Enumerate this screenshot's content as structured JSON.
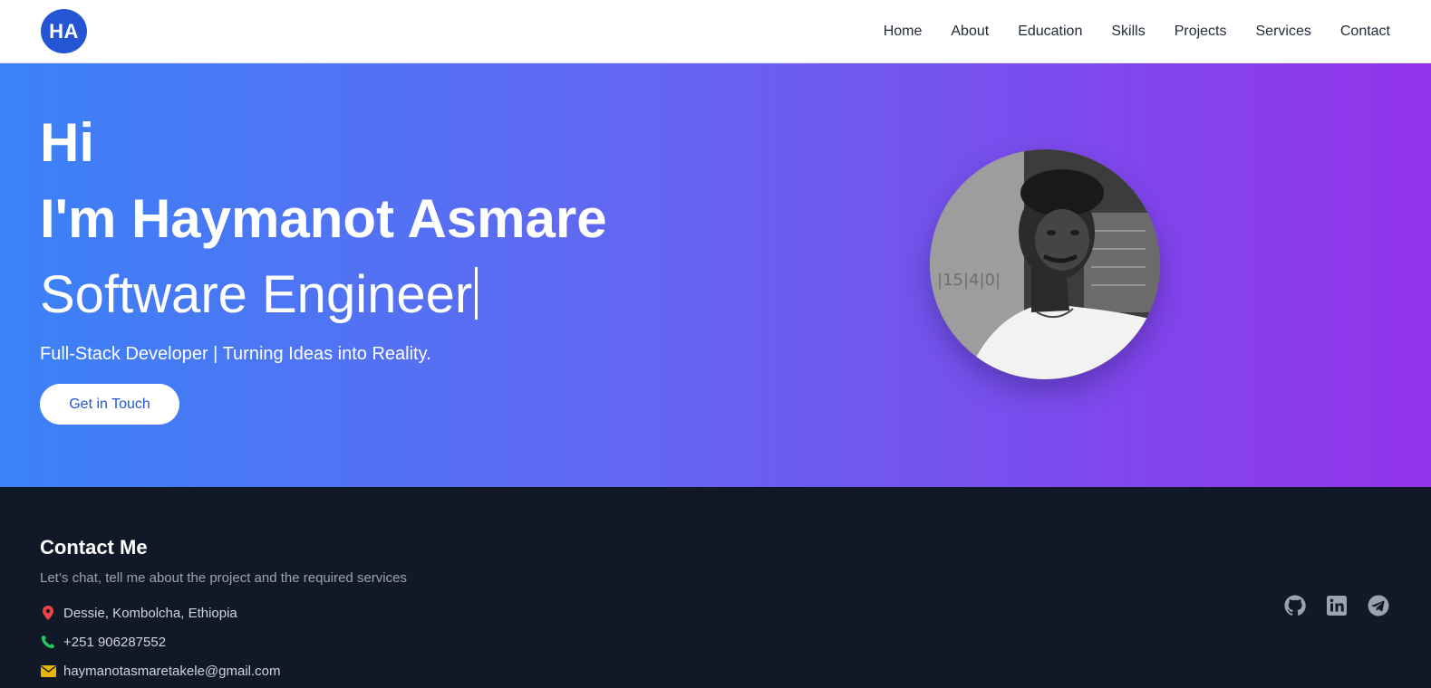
{
  "header": {
    "logo_text": "HA",
    "nav": [
      {
        "label": "Home"
      },
      {
        "label": "About"
      },
      {
        "label": "Education"
      },
      {
        "label": "Skills"
      },
      {
        "label": "Projects"
      },
      {
        "label": "Services"
      },
      {
        "label": "Contact"
      }
    ]
  },
  "hero": {
    "greeting": "Hi",
    "name": "I'm Haymanot Asmare",
    "role": "Software Engineer",
    "tagline": "Full-Stack Developer | Turning Ideas into Reality.",
    "cta_label": "Get in Touch",
    "gradient_colors": [
      "#3b82f6",
      "#6366f1",
      "#9333ea"
    ]
  },
  "contact": {
    "title": "Contact Me",
    "subtitle": "Let’s chat, tell me about the project and the required services",
    "location": "Dessie, Kombolcha, Ethiopia",
    "phone": "+251 906287552",
    "email": "haymanotasmaretakele@gmail.com",
    "icons": {
      "location": "map-pin-icon",
      "phone": "phone-icon",
      "email": "envelope-icon"
    },
    "socials": [
      "github-icon",
      "linkedin-icon",
      "telegram-icon"
    ]
  },
  "colors": {
    "brand": "#2456d4",
    "footer_bg": "#111827",
    "location_icon": "#ef4444",
    "phone_icon": "#22c55e",
    "email_icon": "#eab308"
  }
}
